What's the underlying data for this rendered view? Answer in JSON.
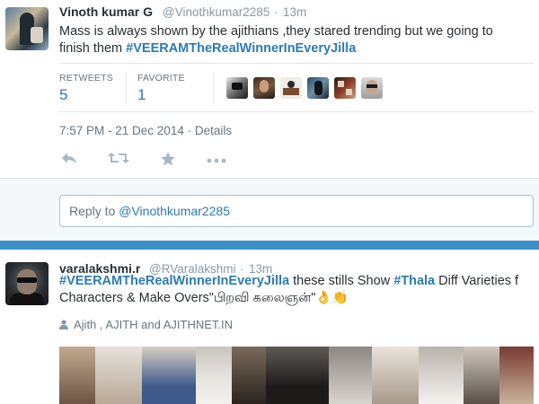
{
  "tweet1": {
    "name": "Vinoth kumar G",
    "handle": "@Vinothkumar2285",
    "separator": "·",
    "time": "13m",
    "text_line1": "Mass is always shown by the ajithians ,they stared trending but we going to",
    "text_line2_plain": "finish them  ",
    "hashtag": "#VEERAMTheRealWinnerInEveryJilla",
    "stats": {
      "retweets_label": "RETWEETS",
      "retweets_value": "5",
      "favorites_label": "FAVORITE",
      "favorites_value": "1"
    },
    "timestamp": "7:57 PM - 21 Dec 2014",
    "timestamp_sep": " · ",
    "details_link": "Details",
    "actions": {
      "reply_icon": "reply-icon",
      "retweet_icon": "retweet-icon",
      "favorite_icon": "star-icon",
      "more_icon": "more-icon"
    },
    "reply_prefix": "Reply to ",
    "reply_mention": "@Vinothkumar2285"
  },
  "tweet2": {
    "name": "varalakshmi.r",
    "handle": "@RVaralakshmi",
    "separator": "·",
    "time": "13m",
    "hashtag1": "#VEERAMTheRealWinnerInEveryJilla",
    "text_mid": " these stills Show ",
    "hashtag2": "#Thala",
    "text_end": "  Diff Varieties f",
    "text_line2": "Characters & Make Overs\"பிறவி கலைஞன்\"",
    "emoji": "👌👏",
    "context": "Ajith , AJITH and AJITHNET.IN"
  },
  "colors": {
    "link": "#2b7bb9",
    "muted": "#8899a6",
    "divider_bar": "#3a91c8",
    "reply_bg": "#f5f8fa"
  }
}
